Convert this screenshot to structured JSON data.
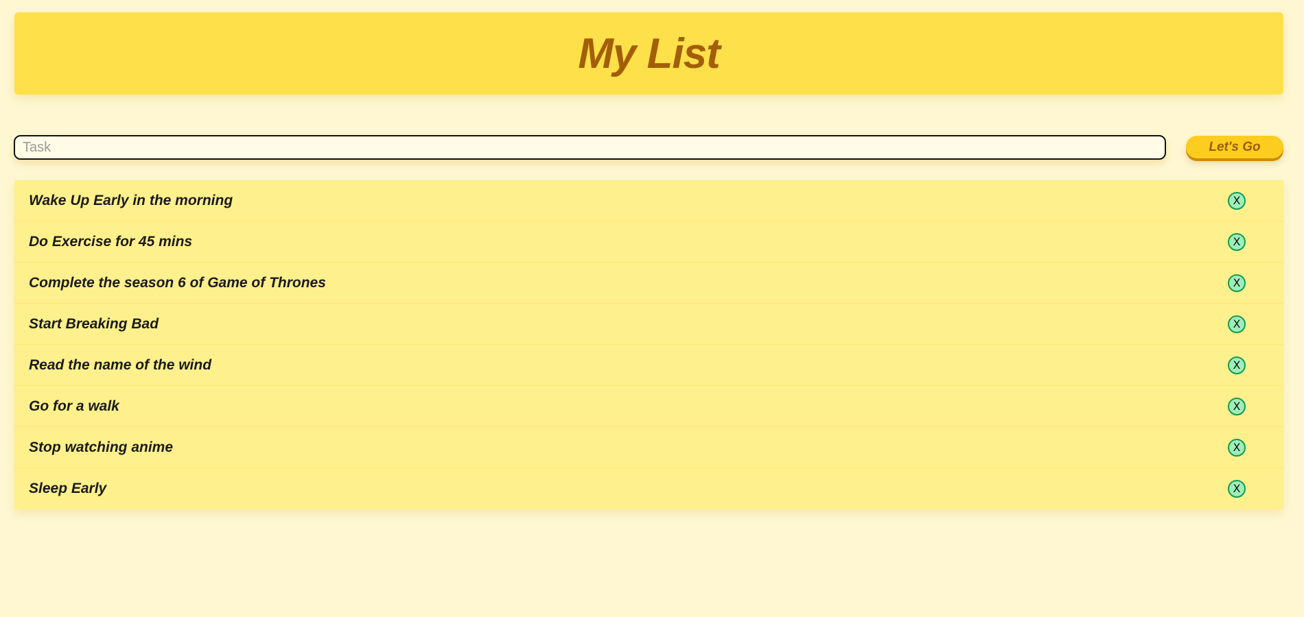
{
  "header": {
    "title": "My List"
  },
  "task_input": {
    "value": "",
    "placeholder": "Task"
  },
  "submit_button": {
    "label": "Let's Go"
  },
  "tasks": [
    {
      "text": "Wake Up Early in the morning"
    },
    {
      "text": "Do Exercise for 45 mins"
    },
    {
      "text": "Complete the season 6 of Game of Thrones"
    },
    {
      "text": "Start Breaking Bad"
    },
    {
      "text": "Read the name of the wind"
    },
    {
      "text": "Go for a walk"
    },
    {
      "text": "Stop watching anime"
    },
    {
      "text": "Sleep Early"
    }
  ],
  "delete_button": {
    "symbol": "X",
    "icon": "close-circle-icon"
  },
  "colors": {
    "page_background": "#fef7d1",
    "header_background": "#fee04a",
    "title_color": "#a35e08",
    "item_background": "#fef08c",
    "button_background": "#fccd1e",
    "button_text": "#9c5c08",
    "delete_fill": "#9eeeb8",
    "delete_border": "#149a52"
  }
}
